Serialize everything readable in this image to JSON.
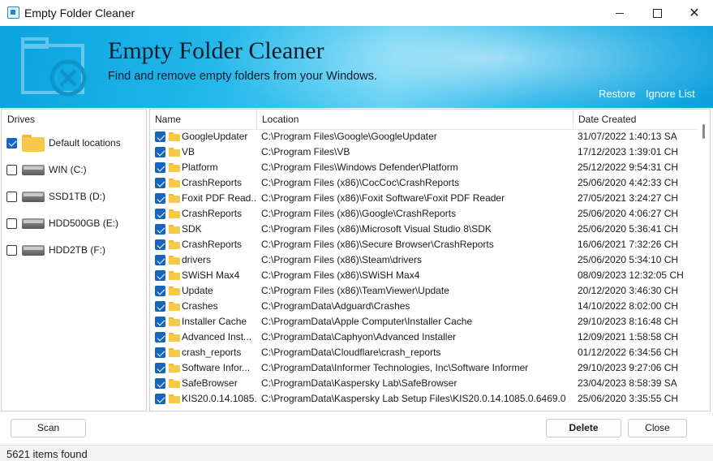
{
  "window": {
    "title": "Empty Folder Cleaner",
    "minimize_icon": "minimize-icon",
    "maximize_icon": "maximize-icon",
    "close_glyph": "✕"
  },
  "banner": {
    "title": "Empty Folder Cleaner",
    "subtitle": "Find and remove empty folders from your Windows.",
    "restore_label": "Restore",
    "ignore_list_label": "Ignore List"
  },
  "drives": {
    "header": "Drives",
    "items": [
      {
        "label": "Default locations",
        "checked": true,
        "icon": "folder-icon"
      },
      {
        "label": "WIN (C:)",
        "checked": false,
        "icon": "drive-icon"
      },
      {
        "label": "SSD1TB (D:)",
        "checked": false,
        "icon": "drive-icon"
      },
      {
        "label": "HDD500GB (E:)",
        "checked": false,
        "icon": "drive-icon"
      },
      {
        "label": "HDD2TB (F:)",
        "checked": false,
        "icon": "drive-icon"
      }
    ]
  },
  "list": {
    "columns": {
      "name": "Name",
      "location": "Location",
      "date": "Date Created"
    },
    "rows": [
      {
        "name": "GoogleUpdater",
        "location": "C:\\Program Files\\Google\\GoogleUpdater",
        "date": "31/07/2022 1:40:13 SA"
      },
      {
        "name": "VB",
        "location": "C:\\Program Files\\VB",
        "date": "17/12/2023 1:39:01 CH"
      },
      {
        "name": "Platform",
        "location": "C:\\Program Files\\Windows Defender\\Platform",
        "date": "25/12/2022 9:54:31 CH"
      },
      {
        "name": "CrashReports",
        "location": "C:\\Program Files (x86)\\CocCoc\\CrashReports",
        "date": "25/06/2020 4:42:33 CH"
      },
      {
        "name": "Foxit PDF Read...",
        "location": "C:\\Program Files (x86)\\Foxit Software\\Foxit PDF Reader",
        "date": "27/05/2021 3:24:27 CH"
      },
      {
        "name": "CrashReports",
        "location": "C:\\Program Files (x86)\\Google\\CrashReports",
        "date": "25/06/2020 4:06:27 CH"
      },
      {
        "name": "SDK",
        "location": "C:\\Program Files (x86)\\Microsoft Visual Studio 8\\SDK",
        "date": "25/06/2020 5:36:41 CH"
      },
      {
        "name": "CrashReports",
        "location": "C:\\Program Files (x86)\\Secure Browser\\CrashReports",
        "date": "16/06/2021 7:32:26 CH"
      },
      {
        "name": "drivers",
        "location": "C:\\Program Files (x86)\\Steam\\drivers",
        "date": "25/06/2020 5:34:10 CH"
      },
      {
        "name": "SWiSH Max4",
        "location": "C:\\Program Files (x86)\\SWiSH Max4",
        "date": "08/09/2023 12:32:05 CH"
      },
      {
        "name": "Update",
        "location": "C:\\Program Files (x86)\\TeamViewer\\Update",
        "date": "20/12/2020 3:46:30 CH"
      },
      {
        "name": "Crashes",
        "location": "C:\\ProgramData\\Adguard\\Crashes",
        "date": "14/10/2022 8:02:00 CH"
      },
      {
        "name": "Installer Cache",
        "location": "C:\\ProgramData\\Apple Computer\\Installer Cache",
        "date": "29/10/2023 8:16:48 CH"
      },
      {
        "name": "Advanced Inst...",
        "location": "C:\\ProgramData\\Caphyon\\Advanced Installer",
        "date": "12/09/2021 1:58:58 CH"
      },
      {
        "name": "crash_reports",
        "location": "C:\\ProgramData\\Cloudflare\\crash_reports",
        "date": "01/12/2022 6:34:56 CH"
      },
      {
        "name": "Software Infor...",
        "location": "C:\\ProgramData\\Informer Technologies, Inc\\Software Informer",
        "date": "29/10/2023 9:27:06 CH"
      },
      {
        "name": "SafeBrowser",
        "location": "C:\\ProgramData\\Kaspersky Lab\\SafeBrowser",
        "date": "23/04/2023 8:58:39 SA"
      },
      {
        "name": "KIS20.0.14.1085...",
        "location": "C:\\ProgramData\\Kaspersky Lab Setup Files\\KIS20.0.14.1085.0.6469.0",
        "date": "25/06/2020 3:35:55 CH"
      }
    ]
  },
  "buttons": {
    "scan": "Scan",
    "delete": "Delete",
    "close": "Close"
  },
  "status": {
    "text": "5621 items found"
  }
}
